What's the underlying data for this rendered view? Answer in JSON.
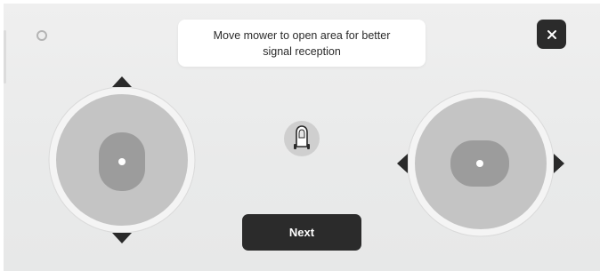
{
  "toast": {
    "message": "Move mower to open area for better signal reception"
  },
  "buttons": {
    "next_label": "Next",
    "close_icon": "close-icon"
  },
  "joysticks": {
    "left": {
      "orientation": "vertical",
      "icon": "directional-joystick"
    },
    "right": {
      "orientation": "horizontal",
      "icon": "directional-joystick"
    }
  },
  "mower": {
    "icon": "robot-mower-icon"
  },
  "colors": {
    "background": "#ebebeb",
    "button_dark": "#2b2b2b",
    "joystick_outer": "#f4f4f4",
    "joystick_pad": "#c4c4c4",
    "joystick_thumb": "#9c9c9c",
    "arrow": "#2a2a2a"
  }
}
